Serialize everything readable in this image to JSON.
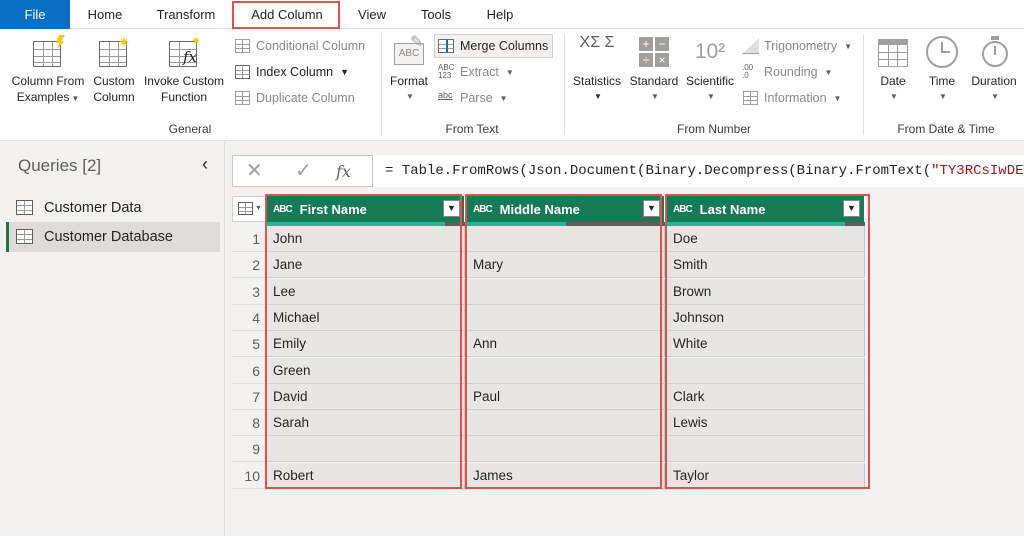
{
  "menu": {
    "tabs": [
      "File",
      "Home",
      "Transform",
      "Add Column",
      "View",
      "Tools",
      "Help"
    ],
    "active": "Add Column"
  },
  "ribbon": {
    "general": {
      "title": "General",
      "column_from_examples": [
        "Column From",
        "Examples"
      ],
      "custom_column": [
        "Custom",
        "Column"
      ],
      "invoke_custom_function": [
        "Invoke Custom",
        "Function"
      ],
      "conditional_column": "Conditional Column",
      "index_column": "Index Column",
      "duplicate_column": "Duplicate Column"
    },
    "from_text": {
      "title": "From Text",
      "format": "Format",
      "merge_columns": "Merge Columns",
      "extract": "Extract",
      "parse": "Parse",
      "abc_label": "ABC",
      "abc123_label": "ABC\n123",
      "abc_small_label": "abc"
    },
    "from_number": {
      "title": "From Number",
      "statistics": "Statistics",
      "standard": "Standard",
      "scientific": "Scientific",
      "trigonometry": "Trigonometry",
      "rounding": "Rounding",
      "information": "Information",
      "sigma_glyph": "XΣ Σ",
      "scientific_glyph": "10²"
    },
    "from_date_time": {
      "title": "From Date & Time",
      "date": "Date",
      "time": "Time",
      "duration": "Duration"
    }
  },
  "queries": {
    "title": "Queries [2]",
    "items": [
      "Customer Data",
      "Customer Database"
    ],
    "selected": "Customer Database"
  },
  "formula": {
    "prefix": "= Table.FromRows(Json.Document(Binary.Decompress(Binary.FromText(",
    "string_part": "\"TY3RCsIwDEX",
    "fx": "fx",
    "cancel_glyph": "✕",
    "commit_glyph": "✓"
  },
  "table": {
    "columns": [
      {
        "type": "ABC",
        "name": "First Name"
      },
      {
        "type": "ABC",
        "name": "Middle Name"
      },
      {
        "type": "ABC",
        "name": "Last Name"
      }
    ],
    "rows": [
      [
        "1",
        "John",
        "",
        "Doe"
      ],
      [
        "2",
        "Jane",
        "Mary",
        "Smith"
      ],
      [
        "3",
        "Lee",
        "",
        "Brown"
      ],
      [
        "4",
        "Michael",
        "",
        "Johnson"
      ],
      [
        "5",
        "Emily",
        "Ann",
        "White"
      ],
      [
        "6",
        "Green",
        "",
        ""
      ],
      [
        "7",
        "David",
        "Paul",
        "Clark"
      ],
      [
        "8",
        "Sarah",
        "",
        "Lewis"
      ],
      [
        "9",
        "",
        "",
        ""
      ],
      [
        "10",
        "Robert",
        "James",
        "Taylor"
      ]
    ]
  },
  "colors": {
    "file_tab": "#0a6fc2",
    "header_green": "#167a55",
    "quality_valid": "#1db992",
    "quality_empty": "#5f5e5c",
    "highlight_red": "#d9534f"
  }
}
